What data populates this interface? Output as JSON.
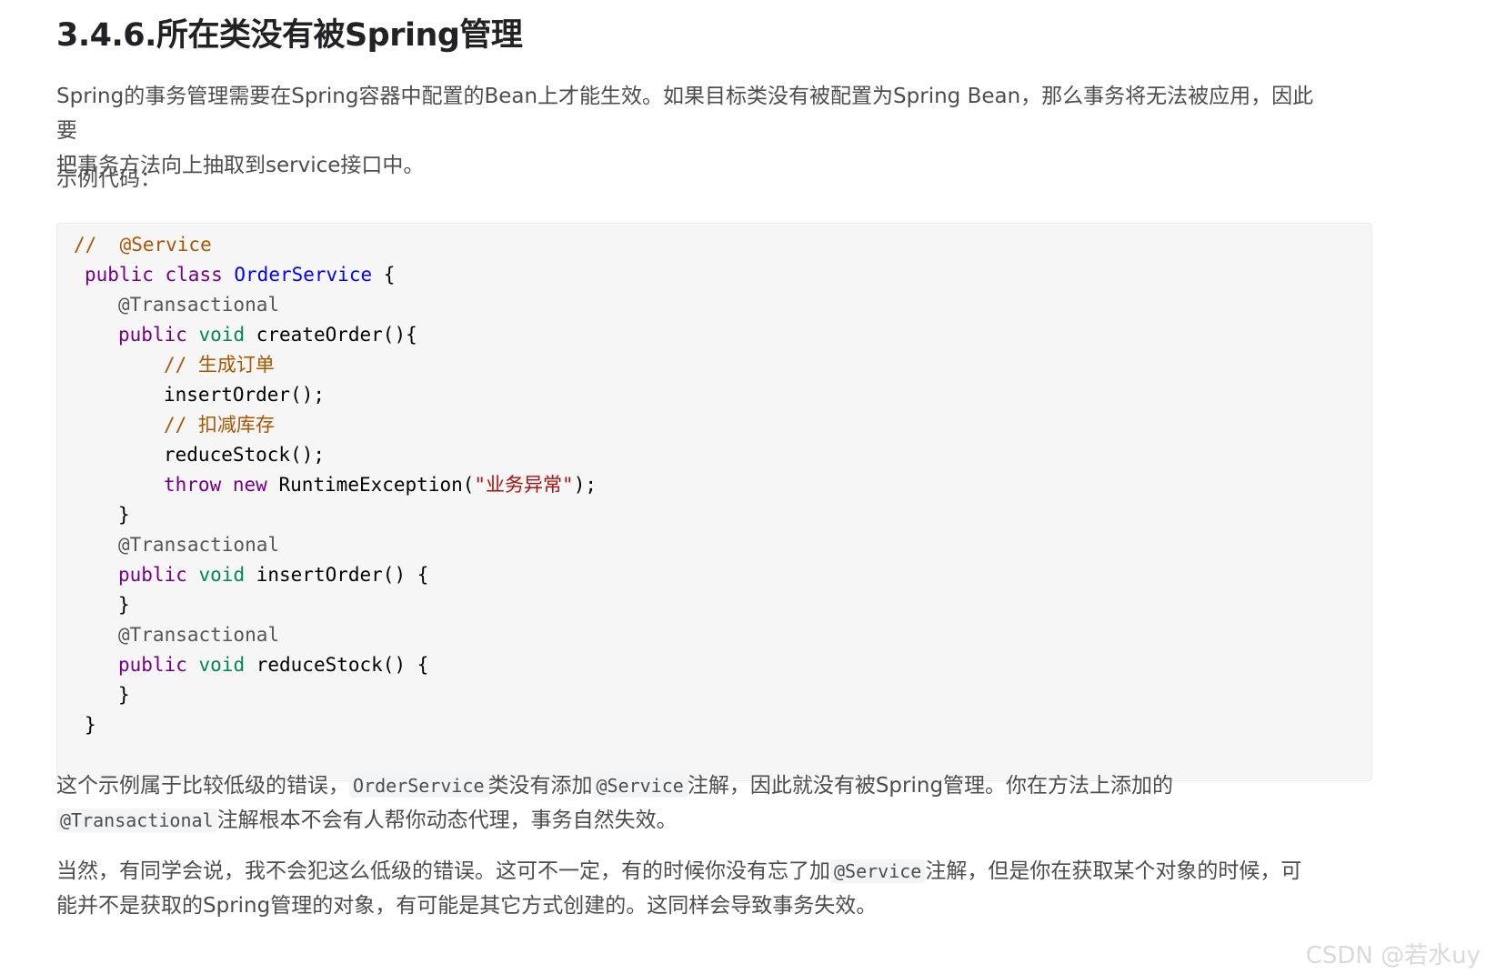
{
  "heading": "3.4.6.所在类没有被Spring管理",
  "intro": {
    "line1": "Spring的事务管理需要在Spring容器中配置的Bean上才能生效。如果目标类没有被配置为Spring Bean，那么事务将无法被应用，因此要",
    "line2": "把事务方法向上抽取到service接口中。"
  },
  "example_label": "示例代码：",
  "code": {
    "l1_comment": "//  @Service",
    "l2_public": "public",
    "l2_class": "class",
    "l2_name": "OrderService",
    "l2_rest": " {",
    "l3": "@Transactional",
    "l4_public": "public",
    "l4_void": "void",
    "l4_rest": " createOrder(){",
    "l5_comment": "// 生成订单",
    "l6": "insertOrder();",
    "l7_comment": "// 扣减库存",
    "l8": "reduceStock();",
    "l9_throw": "throw",
    "l9_new": "new",
    "l9_mid": " RuntimeException(",
    "l9_str": "\"业务异常\"",
    "l9_end": ");",
    "l10": "}",
    "l11": "@Transactional",
    "l12_public": "public",
    "l12_void": "void",
    "l12_rest": " insertOrder() {",
    "l13": "}",
    "l14": "@Transactional",
    "l15_public": "public",
    "l15_void": "void",
    "l15_rest": " reduceStock() {",
    "l16": "}",
    "l17": "}"
  },
  "para2": {
    "a": "这个示例属于比较低级的错误，",
    "code1": "OrderService",
    "b": "类没有添加",
    "code2": "@Service",
    "c": "注解，因此就没有被Spring管理。你在方法上添加的",
    "code3": "@Transactional",
    "d": "注解根本不会有人帮你动态代理，事务自然失效。"
  },
  "para3": {
    "a": "当然，有同学会说，我不会犯这么低级的错误。这可不一定，有的时候你没有忘了加",
    "code1": "@Service",
    "b": "注解，但是你在获取某个对象的时候，可",
    "c": "能并不是获取的Spring管理的对象，有可能是其它方式创建的。这同样会导致事务失效。"
  },
  "watermark": "CSDN @若水uy"
}
